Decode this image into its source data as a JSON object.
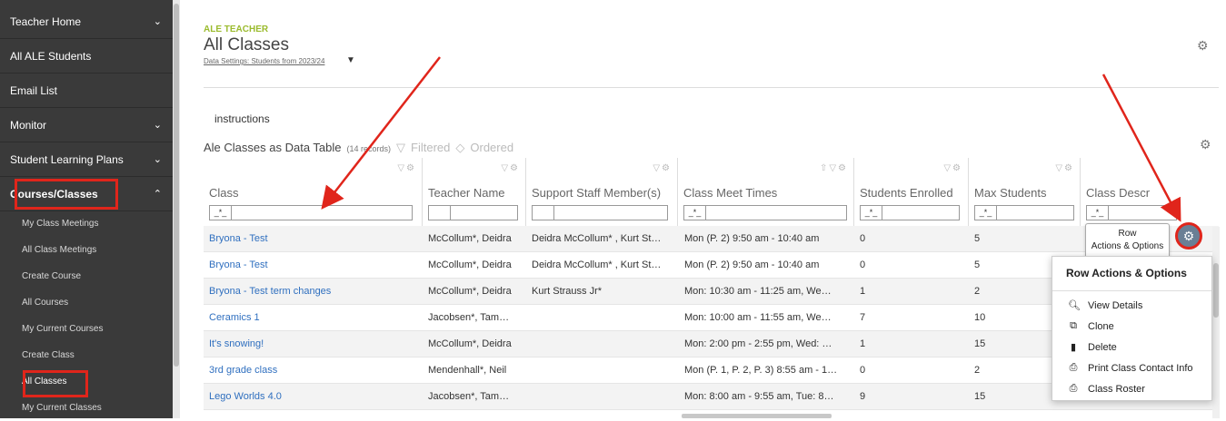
{
  "sidebar": {
    "items": [
      {
        "label": "Teacher Home",
        "chevron": "v"
      },
      {
        "label": "All ALE Students",
        "chevron": ""
      },
      {
        "label": "Email List",
        "chevron": ""
      },
      {
        "label": "Monitor",
        "chevron": "v"
      },
      {
        "label": "Student Learning Plans",
        "chevron": "v"
      },
      {
        "label": "Courses/Classes",
        "chevron": "^"
      }
    ],
    "subitems": [
      "My Class Meetings",
      "All Class Meetings",
      "Create Course",
      "All Courses",
      "My Current Courses",
      "Create Class",
      "All Classes",
      "My Current Classes"
    ]
  },
  "header": {
    "brand": "ALE TEACHER",
    "title": "All Classes",
    "data_settings": "Data Settings: Students from 2023/24"
  },
  "instructions": "instructions",
  "table": {
    "title": "Ale Classes as Data Table",
    "count": "(14 records)",
    "filtered": "Filtered",
    "ordered": "Ordered",
    "filter_op": "_*_",
    "columns": [
      "Class",
      "Teacher Name",
      "Support Staff Member(s)",
      "Class Meet Times",
      "Students Enrolled",
      "Max Students",
      "Class Descr"
    ],
    "rows": [
      [
        "Bryona - Test",
        "McCollum*, Deidra",
        "Deidra McCollum* , Kurt St…",
        "Mon (P. 2) 9:50 am - 10:40 am",
        "0",
        "5"
      ],
      [
        "Bryona - Test",
        "McCollum*, Deidra",
        "Deidra McCollum* , Kurt St…",
        "Mon (P. 2) 9:50 am - 10:40 am",
        "0",
        "5"
      ],
      [
        "Bryona - Test term changes",
        "McCollum*, Deidra",
        "Kurt Strauss Jr*",
        "Mon: 10:30 am - 11:25 am, We…",
        "1",
        "2"
      ],
      [
        "Ceramics 1",
        "Jacobsen*, Tam…",
        "",
        "Mon: 10:00 am - 11:55 am, We…",
        "7",
        "10"
      ],
      [
        "It's snowing!",
        "McCollum*, Deidra",
        "",
        "Mon: 2:00 pm - 2:55 pm, Wed: …",
        "1",
        "15"
      ],
      [
        "3rd grade class",
        "Mendenhall*, Neil",
        "",
        "Mon (P. 1, P. 2, P. 3) 8:55 am - 1…",
        "0",
        "2"
      ],
      [
        "Lego Worlds 4.0",
        "Jacobsen*, Tam…",
        "",
        "Mon: 8:00 am - 9:55 am, Tue: 8…",
        "9",
        "15"
      ]
    ]
  },
  "tooltip": {
    "line1": "Row",
    "line2": "Actions & Options"
  },
  "popup": {
    "title": "Row Actions & Options",
    "items": [
      {
        "icon": "search-icon",
        "label": "View Details"
      },
      {
        "icon": "clone-icon",
        "label": "Clone"
      },
      {
        "icon": "trash-icon",
        "label": "Delete"
      },
      {
        "icon": "print-icon",
        "label": "Print Class Contact Info"
      },
      {
        "icon": "print-icon",
        "label": "Class Roster"
      }
    ]
  },
  "colors": {
    "accent_green": "#9bbb2e",
    "link_blue": "#2f6fbf",
    "highlight_red": "#e0251b",
    "sidebar_bg": "#3a3a3a"
  }
}
